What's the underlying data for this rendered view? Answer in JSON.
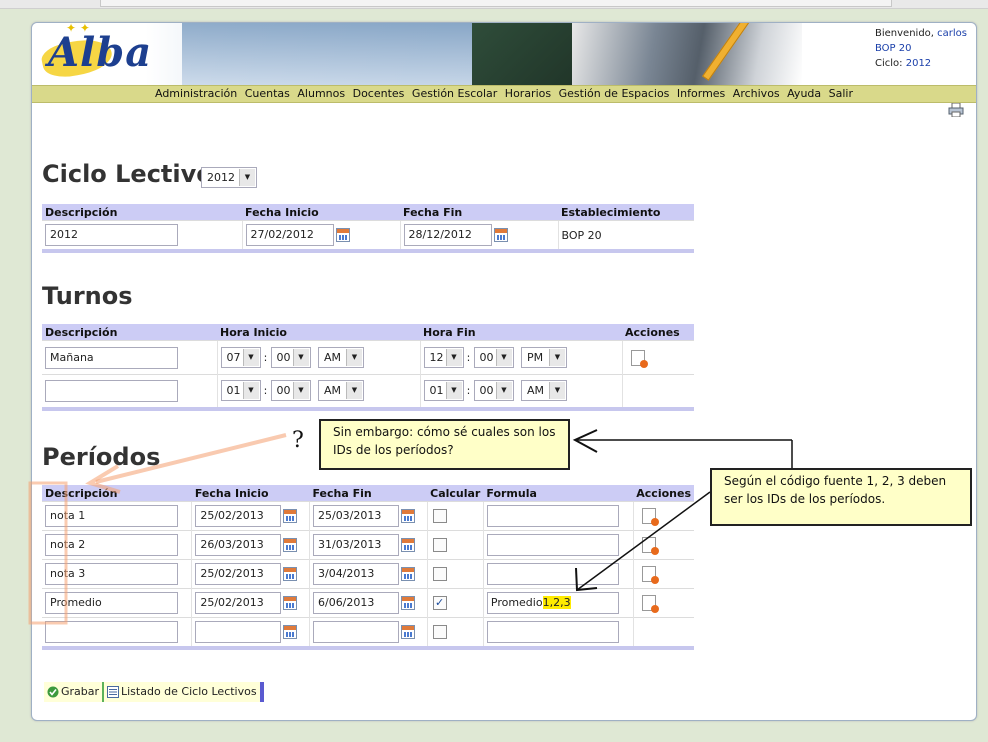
{
  "header": {
    "logo": "Alba",
    "welcome_label": "Bienvenido,",
    "user": "carlos",
    "school": "BOP 20",
    "cycle_label": "Ciclo:",
    "cycle": "2012"
  },
  "menu": [
    "Administración",
    "Cuentas",
    "Alumnos",
    "Docentes",
    "Gestión Escolar",
    "Horarios",
    "Gestión de Espacios",
    "Informes",
    "Archivos",
    "Ayuda",
    "Salir"
  ],
  "ciclo": {
    "title": "Ciclo Lectivo",
    "selected_year": "2012",
    "headers": [
      "Descripción",
      "Fecha Inicio",
      "Fecha Fin",
      "Establecimiento"
    ],
    "row": {
      "descripcion": "2012",
      "fecha_inicio": "27/02/2012",
      "fecha_fin": "28/12/2012",
      "establecimiento": "BOP 20"
    }
  },
  "turnos": {
    "title": "Turnos",
    "headers": [
      "Descripción",
      "Hora Inicio",
      "Hora Fin",
      "Acciones"
    ],
    "rows": [
      {
        "descripcion": "Mañana",
        "ini_h": "07",
        "ini_m": "00",
        "ini_ap": "AM",
        "fin_h": "12",
        "fin_m": "00",
        "fin_ap": "PM"
      },
      {
        "descripcion": "",
        "ini_h": "01",
        "ini_m": "00",
        "ini_ap": "AM",
        "fin_h": "01",
        "fin_m": "00",
        "fin_ap": "AM"
      }
    ]
  },
  "periodos": {
    "title": "Períodos",
    "headers": [
      "Descripción",
      "Fecha Inicio",
      "Fecha Fin",
      "Calcular",
      "Formula",
      "Acciones"
    ],
    "rows": [
      {
        "descripcion": "nota 1",
        "fecha_inicio": "25/02/2013",
        "fecha_fin": "25/03/2013",
        "calcular": "",
        "formula": ""
      },
      {
        "descripcion": "nota 2",
        "fecha_inicio": "26/03/2013",
        "fecha_fin": "31/03/2013",
        "calcular": "",
        "formula": ""
      },
      {
        "descripcion": "nota 3",
        "fecha_inicio": "25/02/2013",
        "fecha_fin": "3/04/2013",
        "calcular": "",
        "formula": ""
      },
      {
        "descripcion": "Promedio",
        "fecha_inicio": "25/02/2013",
        "fecha_fin": "6/06/2013",
        "calcular": "✓",
        "formula": "Promedio",
        "formula_args": "1,2,3"
      },
      {
        "descripcion": "",
        "fecha_inicio": "",
        "fecha_fin": "",
        "calcular": "",
        "formula": ""
      }
    ]
  },
  "annotations": {
    "question_mark": "?",
    "callout1": "Sin embargo: cómo sé cuales son los IDs de los períodos?",
    "callout2": "Según el código fuente 1, 2, 3 deben ser los IDs de los períodos."
  },
  "buttons": {
    "save": "Grabar",
    "list": "Listado de Ciclo Lectivos"
  },
  "colors": {
    "menu_bg": "#d9d98a",
    "header_bg": "#ccccf5",
    "callout_bg": "#ffffc8",
    "highlight": "#ffeb00",
    "annotation_arrow": "#f5a070"
  }
}
